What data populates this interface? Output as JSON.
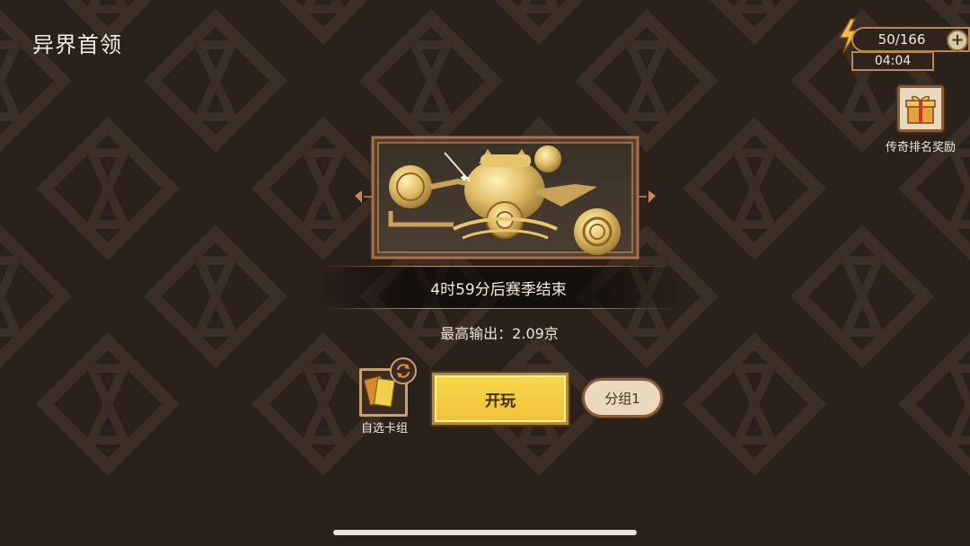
{
  "header": {
    "title": "异界首领"
  },
  "energy": {
    "count": "50/166",
    "timer": "04:04",
    "plus_icon": "plus-icon",
    "bolt_icon": "lightning-icon"
  },
  "reward": {
    "label": "传奇排名奖励",
    "icon": "gift-box-icon"
  },
  "emblem": {
    "icon": "golden-boss-emblem"
  },
  "season": {
    "countdown_text": "4时59分后赛季结束"
  },
  "stats": {
    "best_output": "最高输出：2.09京"
  },
  "deck": {
    "label": "自选卡组",
    "swap_icon": "swap-refresh-icon"
  },
  "actions": {
    "play_label": "开玩",
    "group_label": "分组1"
  },
  "colors": {
    "background": "#2a211b",
    "pattern": "#3a2e25",
    "gold": "#c4965a",
    "play_button": "#f2cc40"
  }
}
